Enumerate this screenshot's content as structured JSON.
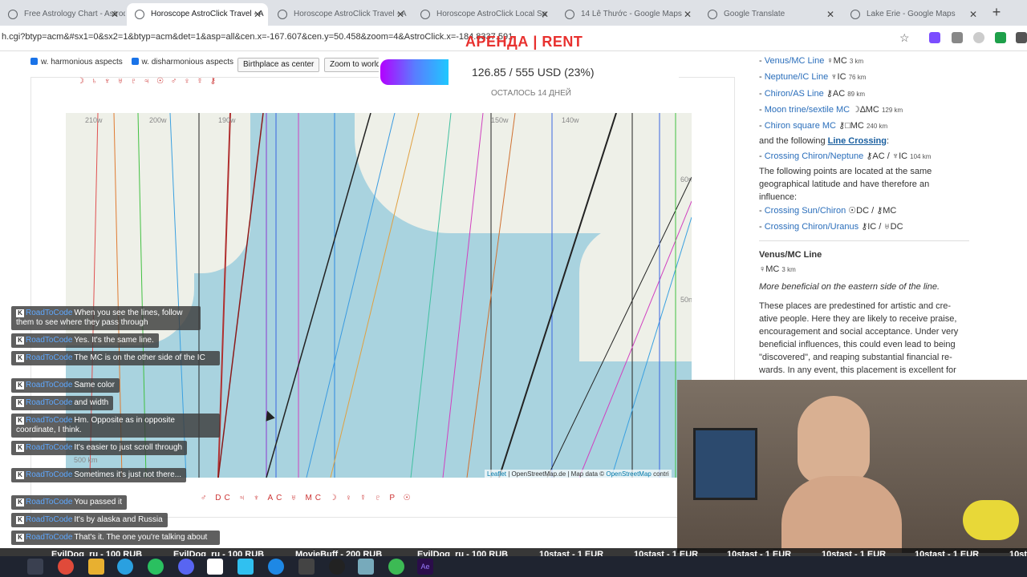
{
  "browser": {
    "tabs": [
      {
        "title": "Free Astrology Chart - Astrodie",
        "active": false
      },
      {
        "title": "Horoscope AstroClick Travel - A",
        "active": true
      },
      {
        "title": "Horoscope AstroClick Travel - A",
        "active": false
      },
      {
        "title": "Horoscope AstroClick Local Sp",
        "active": false
      },
      {
        "title": "14 Lê Thước - Google Maps",
        "active": false
      },
      {
        "title": "Google Translate",
        "active": false
      },
      {
        "title": "Lake Erie - Google Maps",
        "active": false
      }
    ],
    "new_tab": "+",
    "url": "h.cgi?btyp=acm&#sx1=0&sx2=1&btyp=acm&det=1&asp=all&cen.x=-167.607&cen.y=50.458&zoom=4&AstroClick.x=-184.83",
    "url_suffix": "37.591"
  },
  "toolbar": {
    "harmonious_label": "w. harmonious aspects",
    "disharmonious_label": "w. disharmonious aspects",
    "birthplace_center": "Birthplace as center",
    "zoom_world": "Zoom to world"
  },
  "map": {
    "grid_labels": {
      "lon_210": "210w",
      "lon_200": "200w",
      "lon_190": "190w",
      "lon_150": "150w",
      "lon_140": "140w",
      "lat_60": "60n",
      "lat_50": "50n",
      "scale": "500 km"
    },
    "attribution": {
      "leaflet": "Leaflet",
      "source": " | OpenStreetMap.de | Map data © ",
      "osm": "OpenStreetMap",
      "contrib": " contri"
    },
    "top_symbols": "☽ ♄ ♆ ♅ ♇ ♃ ☉ ♂ ♀ ☿ ⚷",
    "bottom_symbols": "♂ DC ♃ ♆ AC ♅ MC ☽ ♀ ☿ ♇ P ☉",
    "colors": {
      "ocean": "#a9d3df",
      "land": "#eef0e8"
    }
  },
  "panel": {
    "lines": [
      {
        "link": "Venus/MC Line",
        "glyph": "♀MC",
        "dist": "3 km"
      },
      {
        "link": "Neptune/IC Line",
        "glyph": "♆IC",
        "dist": "76 km"
      },
      {
        "link": "Chiron/AS Line",
        "glyph": "⚷AC",
        "dist": "89 km"
      },
      {
        "link": "Moon trine/sextile MC",
        "glyph": "☽∆MC",
        "dist": "129 km"
      },
      {
        "link": "Chiron square MC",
        "glyph": "⚷□MC",
        "dist": "240 km"
      }
    ],
    "following_text": "and the following",
    "line_crossing": "Line Crossing",
    "colon": ":",
    "crossing1": {
      "link": "Crossing Chiron/Neptune",
      "glyph": "⚷AC / ♆IC",
      "dist": "104 km"
    },
    "latitude_text": "The following points are located at the same geographical latitude and have therefore an influence:",
    "crossing2": {
      "link": "Crossing Sun/Chiron",
      "glyph": "☉DC / ⚷MC"
    },
    "crossing3": {
      "link": "Crossing Chiron/Uranus",
      "glyph": "⚷IC / ♅DC"
    },
    "section_title": "Venus/MC Line",
    "section_glyph": "♀MC",
    "section_dist": "3 km",
    "section_italic": "More beneficial on the eastern side of the line.",
    "section_body": "These places are predestined for artistic and cre-ative people. Here they are likely to receive praise, encouragement and social acceptance. Under very beneficial influences, this could even lead to being \"discovered\", and reaping substantial financial re-wards. In any event, this placement is excellent for"
  },
  "overlay": {
    "rent": "АРЕНДА | RENT",
    "donation_amount": "126.85 / 555 USD (23%)",
    "donation_progress": 0.23,
    "donation_days": "ОСТАЛОСЬ 14 ДНЕЙ"
  },
  "chat": [
    {
      "user": "RoadToCode",
      "text": "When you see the lines, follow them to see where they pass through"
    },
    {
      "user": "RoadToCode",
      "text": "Yes. It's the same line."
    },
    {
      "user": "RoadToCode",
      "text": "The MC is on the other side of the IC"
    },
    {
      "user": "RoadToCode",
      "text": "Same color"
    },
    {
      "user": "RoadToCode",
      "text": "and width"
    },
    {
      "user": "RoadToCode",
      "text": "Hm. Opposite as in opposite coordinate, I think."
    },
    {
      "user": "RoadToCode",
      "text": "It's easier to just scroll through"
    },
    {
      "user": "RoadToCode",
      "text": "Sometimes it's just not there..."
    },
    {
      "user": "RoadToCode",
      "text": "You passed it"
    },
    {
      "user": "RoadToCode",
      "text": "It's by alaska and Russia"
    },
    {
      "user": "RoadToCode",
      "text": "That's it. The one you're talking about"
    }
  ],
  "ticker": [
    "EvilDog_ru - 100 RUB",
    "EvilDog_ru - 100 RUB",
    "MovieBuff - 200 RUB",
    "EvilDog_ru - 100 RUB",
    "10stast - 1 EUR",
    "10stast - 1 EUR",
    "10stast - 1 EUR",
    "10stast - 1 EUR",
    "10stast - 1 EUR",
    "10st"
  ]
}
